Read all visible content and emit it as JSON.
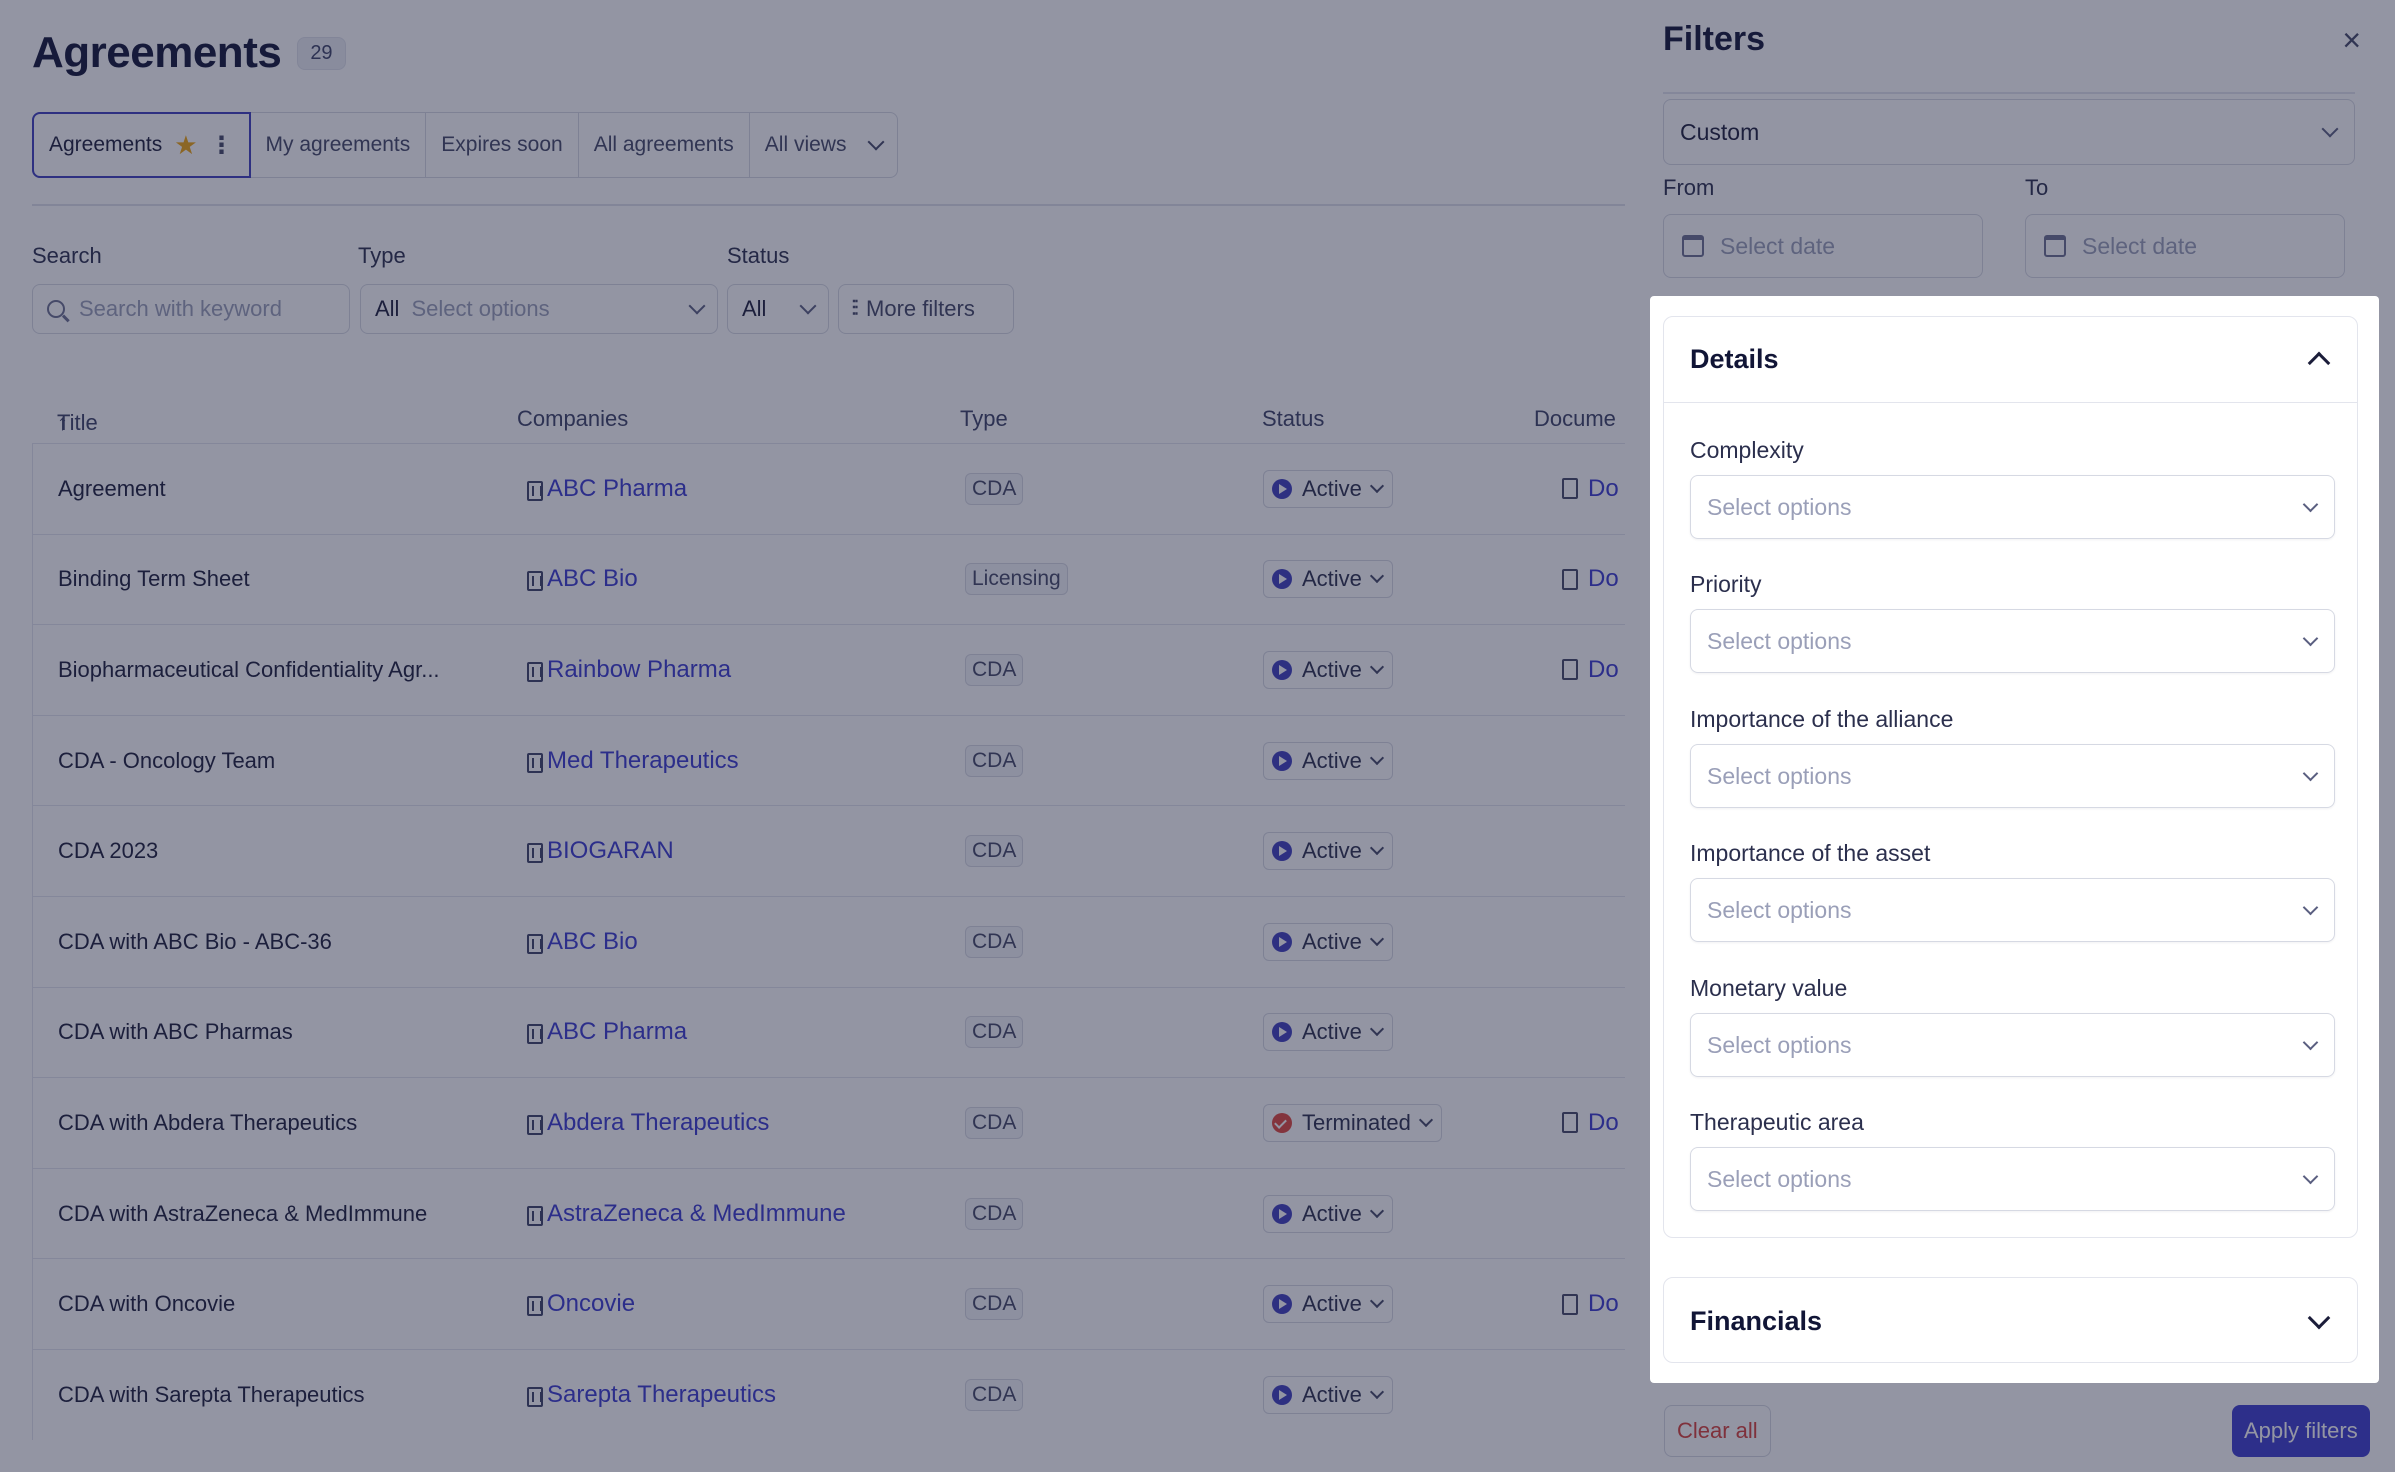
{
  "page": {
    "title": "Agreements",
    "count": "29"
  },
  "views": {
    "tabs": [
      {
        "label": "Agreements"
      },
      {
        "label": "My agreements"
      },
      {
        "label": "Expires soon"
      },
      {
        "label": "All agreements"
      },
      {
        "label": "All views"
      }
    ]
  },
  "filters_bar": {
    "search_label": "Search",
    "search_placeholder": "Search with keyword",
    "type_label": "Type",
    "type_value": "All",
    "type_placeholder": "Select options",
    "status_label": "Status",
    "status_value": "All",
    "more_filters": "More filters"
  },
  "table": {
    "columns": [
      "Title",
      "Companies",
      "Type",
      "Status",
      "Docume"
    ],
    "rows": [
      {
        "title": "Agreement",
        "company": "ABC Pharma",
        "type": "CDA",
        "status": "Active",
        "doc": "Do"
      },
      {
        "title": "Binding Term Sheet",
        "company": "ABC Bio",
        "type": "Licensing",
        "status": "Active",
        "doc": "Do"
      },
      {
        "title": "Biopharmaceutical Confidentiality Agr...",
        "company": "Rainbow Pharma",
        "type": "CDA",
        "status": "Active",
        "doc": "Do"
      },
      {
        "title": "CDA - Oncology Team",
        "company": "Med Therapeutics",
        "type": "CDA",
        "status": "Active",
        "doc": ""
      },
      {
        "title": "CDA 2023",
        "company": "BIOGARAN",
        "type": "CDA",
        "status": "Active",
        "doc": ""
      },
      {
        "title": "CDA with ABC Bio - ABC-36",
        "company": "ABC Bio",
        "type": "CDA",
        "status": "Active",
        "doc": ""
      },
      {
        "title": "CDA with ABC Pharmas",
        "company": "ABC Pharma",
        "type": "CDA",
        "status": "Active",
        "doc": ""
      },
      {
        "title": "CDA with Abdera Therapeutics",
        "company": "Abdera Therapeutics",
        "type": "CDA",
        "status": "Terminated",
        "doc": "Do"
      },
      {
        "title": "CDA with AstraZeneca & MedImmune",
        "company": "AstraZeneca & MedImmune",
        "type": "CDA",
        "status": "Active",
        "doc": ""
      },
      {
        "title": "CDA with Oncovie",
        "company": "Oncovie",
        "type": "CDA",
        "status": "Active",
        "doc": "Do"
      },
      {
        "title": "CDA with Sarepta Therapeutics",
        "company": "Sarepta Therapeutics",
        "type": "CDA",
        "status": "Active",
        "doc": ""
      }
    ]
  },
  "drawer": {
    "title": "Filters",
    "close_icon": "close-icon",
    "period_value": "Custom",
    "from_label": "From",
    "to_label": "To",
    "date_placeholder": "Select date",
    "details": {
      "title": "Details",
      "fields": [
        {
          "label": "Complexity",
          "placeholder": "Select options"
        },
        {
          "label": "Priority",
          "placeholder": "Select options"
        },
        {
          "label": "Importance of the alliance",
          "placeholder": "Select options"
        },
        {
          "label": "Importance of the asset",
          "placeholder": "Select options"
        },
        {
          "label": "Monetary value",
          "placeholder": "Select options"
        },
        {
          "label": "Therapeutic area",
          "placeholder": "Select options"
        }
      ]
    },
    "financials": {
      "title": "Financials"
    },
    "clear_all": "Clear all",
    "apply": "Apply filters"
  },
  "colors": {
    "accent": "#3d3dcf",
    "link": "#3b3bd0",
    "danger": "#d8403a",
    "star": "#f0a50f"
  }
}
